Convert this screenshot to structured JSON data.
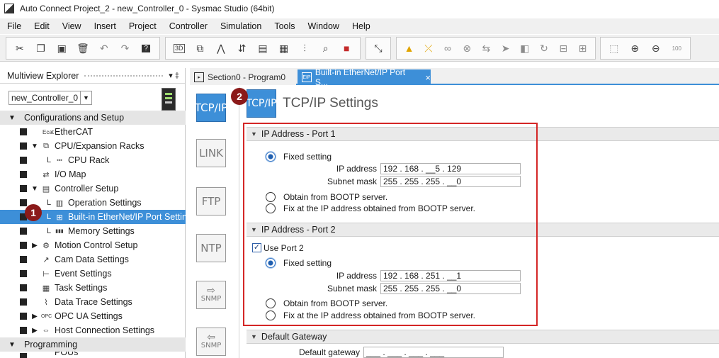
{
  "window": {
    "title": "Auto Connect Project_2 - new_Controller_0 - Sysmac Studio (64bit)"
  },
  "menu": [
    "File",
    "Edit",
    "View",
    "Insert",
    "Project",
    "Controller",
    "Simulation",
    "Tools",
    "Window",
    "Help"
  ],
  "toolbar": {
    "groups": [
      [
        "cut-icon",
        "copy-icon",
        "paste-icon",
        "delete-icon",
        "undo-icon",
        "redo-icon",
        "help-icon"
      ],
      [
        "3d-icon",
        "network-icon",
        "build-icon",
        "transfer-icon",
        "monitor-icon",
        "watch-icon",
        "trace-icon",
        "find-icon",
        "stop-icon"
      ],
      [
        "online-icon"
      ],
      [
        "warning-icon",
        "disconnect-icon",
        "glasses-icon",
        "clear-icon",
        "compare-icon",
        "synchronize-icon",
        "reset-icon",
        "cycle-icon",
        "device-icon",
        "device2-icon"
      ],
      [
        "fit-icon",
        "zoom-in-icon",
        "zoom-out-icon",
        "zoom-100-icon"
      ]
    ],
    "zoom_label": "100"
  },
  "explorer": {
    "title": "Multiview Explorer",
    "pin": "▾ ‡",
    "controller": "new_Controller_0",
    "tree": [
      {
        "label": "Configurations and Setup",
        "kind": "section",
        "expanded": true
      },
      {
        "label": "EtherCAT",
        "icon": "ethercat-icon",
        "depth": 1
      },
      {
        "label": "CPU/Expansion Racks",
        "icon": "rack-icon",
        "depth": 1,
        "expanded": true
      },
      {
        "label": "CPU Rack",
        "icon": "cpu-rack-icon",
        "depth": 2
      },
      {
        "label": "I/O Map",
        "icon": "io-map-icon",
        "depth": 1
      },
      {
        "label": "Controller Setup",
        "icon": "controller-setup-icon",
        "depth": 1,
        "expanded": true
      },
      {
        "label": "Operation Settings",
        "icon": "operation-settings-icon",
        "depth": 2
      },
      {
        "label": "Built-in EtherNet/IP Port Settings",
        "icon": "ethernet-icon",
        "depth": 2,
        "selected": true
      },
      {
        "label": "Memory Settings",
        "icon": "memory-icon",
        "depth": 2
      },
      {
        "label": "Motion Control Setup",
        "icon": "motion-icon",
        "depth": 1,
        "collapsed": true
      },
      {
        "label": "Cam Data Settings",
        "icon": "cam-icon",
        "depth": 1
      },
      {
        "label": "Event Settings",
        "icon": "event-icon",
        "depth": 1
      },
      {
        "label": "Task Settings",
        "icon": "task-icon",
        "depth": 1
      },
      {
        "label": "Data Trace Settings",
        "icon": "trace-icon",
        "depth": 1
      },
      {
        "label": "OPC UA Settings",
        "icon": "opcua-icon",
        "depth": 1,
        "collapsed": true
      },
      {
        "label": "Host Connection Settings",
        "icon": "host-icon",
        "depth": 1,
        "collapsed": true
      },
      {
        "label": "Programming",
        "kind": "section",
        "expanded": true
      },
      {
        "label": "POUs",
        "icon": "pou-icon",
        "depth": 1,
        "expanded": true
      }
    ]
  },
  "tabs": [
    {
      "label": "Section0 - Program0",
      "active": false
    },
    {
      "label": "Built-in EtherNet/IP Port S...",
      "active": true,
      "close": "×"
    }
  ],
  "side_nav": [
    "TCP/IP",
    "LINK",
    "FTP",
    "NTP",
    "SNMP",
    "SNMP"
  ],
  "content": {
    "title": "TCP/IP Settings",
    "head_icon": "TCP/IP",
    "port1": {
      "header": "IP Address - Port 1",
      "fixed_label": "Fixed setting",
      "ip_label": "IP address",
      "ip_value": "192 . 168 . __5 . 129",
      "mask_label": "Subnet mask",
      "mask_value": "255 . 255 . 255 . __0",
      "bootp_label": "Obtain from BOOTP server.",
      "fix_bootp_label": "Fix at the IP address obtained from BOOTP server."
    },
    "port2": {
      "header": "IP Address - Port 2",
      "use_port_label": "Use Port 2",
      "fixed_label": "Fixed setting",
      "ip_label": "IP address",
      "ip_value": "192 . 168 . 251 . __1",
      "mask_label": "Subnet mask",
      "mask_value": "255 . 255 . 255 . __0",
      "bootp_label": "Obtain from BOOTP server.",
      "fix_bootp_label": "Fix at the IP address obtained from BOOTP server."
    },
    "gateway": {
      "header": "Default Gateway",
      "label": "Default gateway",
      "value": "___ . ___ . ___ . ___"
    }
  },
  "badges": [
    "1",
    "2"
  ],
  "colors": {
    "accent": "#3d8fd8",
    "highlight": "#d42626",
    "badge": "#8b1a1a"
  }
}
